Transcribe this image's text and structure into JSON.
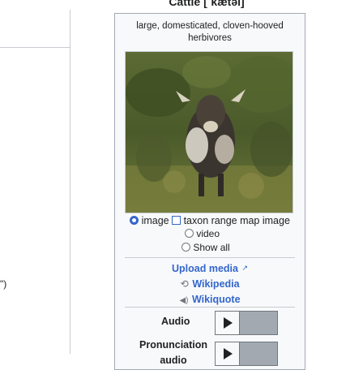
{
  "header": {
    "title": "Cattle [ˈkætəl]"
  },
  "left": {
    "fragment": "\")"
  },
  "infobox": {
    "description": "large, domesticated, cloven-hooved herbivores",
    "media_options": {
      "image": "image",
      "taxon_map": "taxon range map image",
      "video": "video",
      "show_all": "Show all"
    },
    "upload_label": "Upload media",
    "wikipedia_label": "Wikipedia",
    "wikiquote_label": "Wikiquote",
    "audio_label": "Audio",
    "pronunciation_label": "Pronunciation audio"
  },
  "colors": {
    "link": "#3366cc",
    "border": "#a2a9b1",
    "background": "#f8f9fa"
  }
}
